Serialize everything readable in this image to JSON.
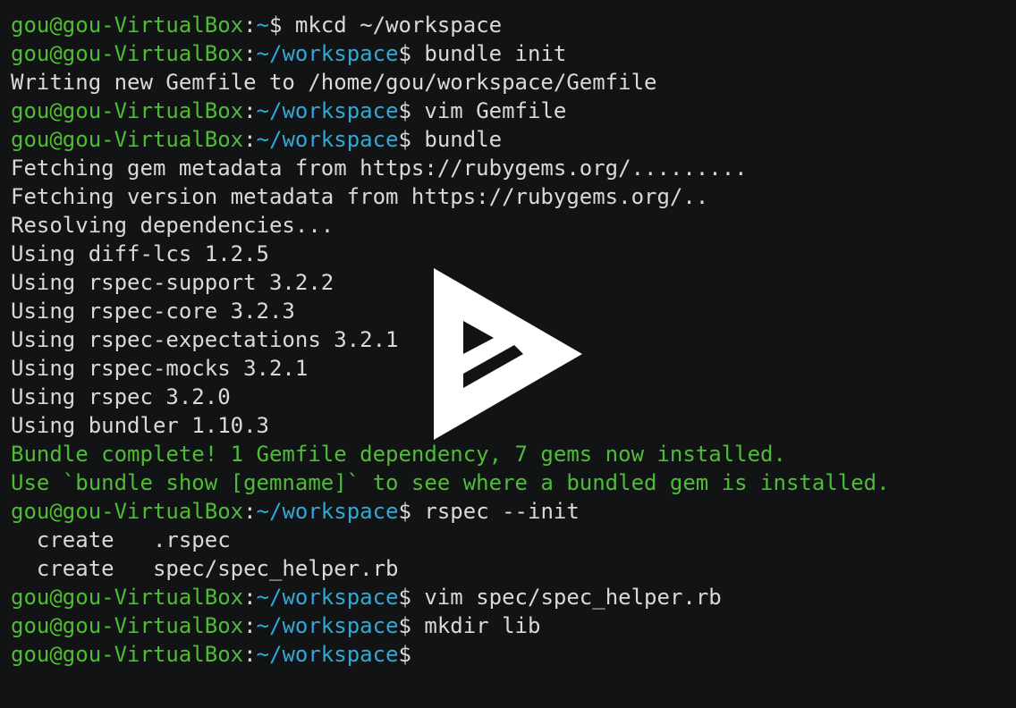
{
  "terminal": {
    "colors": {
      "background": "#121314",
      "text": "#d9d9d9",
      "prompt_user": "#4ebd36",
      "prompt_path": "#32a8d6",
      "success": "#4ebd36"
    },
    "prompt": {
      "user_host": "gou@gou-VirtualBox",
      "colon": ":",
      "dollar": "$"
    },
    "lines": [
      {
        "type": "prompt",
        "path": "~",
        "command": " mkcd ~/workspace"
      },
      {
        "type": "prompt",
        "path": "~/workspace",
        "command": " bundle init"
      },
      {
        "type": "output",
        "text": "Writing new Gemfile to /home/gou/workspace/Gemfile"
      },
      {
        "type": "prompt",
        "path": "~/workspace",
        "command": " vim Gemfile"
      },
      {
        "type": "prompt",
        "path": "~/workspace",
        "command": " bundle"
      },
      {
        "type": "output",
        "text": "Fetching gem metadata from https://rubygems.org/........."
      },
      {
        "type": "output",
        "text": "Fetching version metadata from https://rubygems.org/.."
      },
      {
        "type": "output",
        "text": "Resolving dependencies..."
      },
      {
        "type": "output",
        "text": "Using diff-lcs 1.2.5"
      },
      {
        "type": "output",
        "text": "Using rspec-support 3.2.2"
      },
      {
        "type": "output",
        "text": "Using rspec-core 3.2.3"
      },
      {
        "type": "output",
        "text": "Using rspec-expectations 3.2.1"
      },
      {
        "type": "output",
        "text": "Using rspec-mocks 3.2.1"
      },
      {
        "type": "output",
        "text": "Using rspec 3.2.0"
      },
      {
        "type": "output",
        "text": "Using bundler 1.10.3"
      },
      {
        "type": "success",
        "text": "Bundle complete! 1 Gemfile dependency, 7 gems now installed."
      },
      {
        "type": "success",
        "text": "Use `bundle show [gemname]` to see where a bundled gem is installed."
      },
      {
        "type": "prompt",
        "path": "~/workspace",
        "command": " rspec --init"
      },
      {
        "type": "output",
        "text": "  create   .rspec"
      },
      {
        "type": "output",
        "text": "  create   spec/spec_helper.rb"
      },
      {
        "type": "prompt",
        "path": "~/workspace",
        "command": " vim spec/spec_helper.rb"
      },
      {
        "type": "prompt",
        "path": "~/workspace",
        "command": " mkdir lib"
      },
      {
        "type": "prompt",
        "path": "~/workspace",
        "command": ""
      }
    ]
  },
  "overlay": {
    "icon": "asciinema-play-icon",
    "color": "#ffffff"
  }
}
